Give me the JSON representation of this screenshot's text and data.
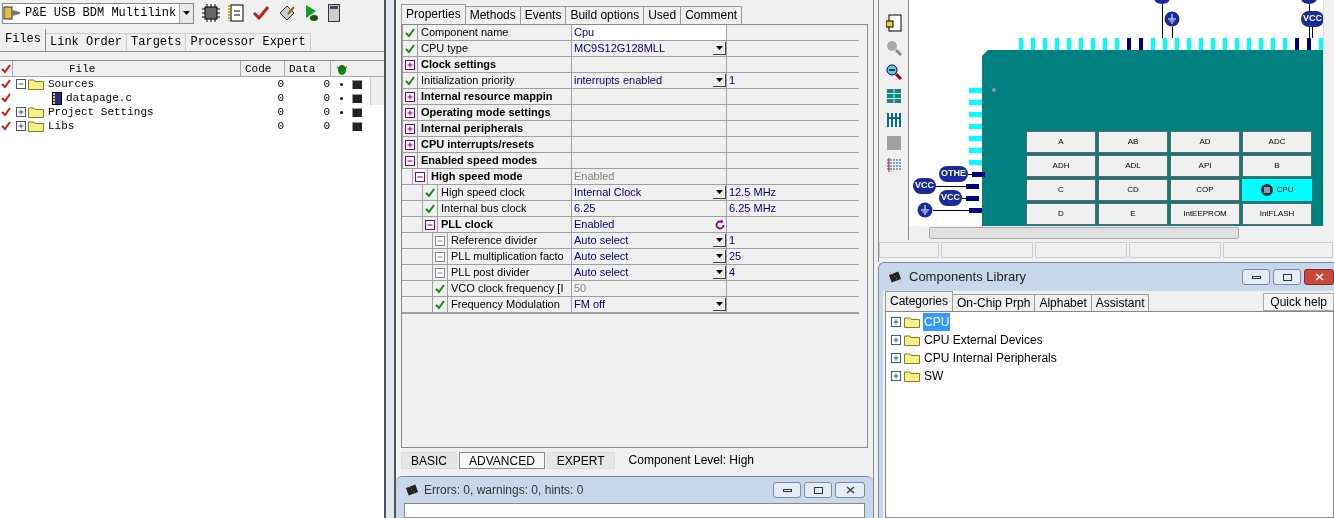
{
  "debugger": {
    "connection": "P&E USB BDM Multilink"
  },
  "project_tabs": [
    {
      "label": "Files",
      "selected": true
    },
    {
      "label": "Link Order",
      "selected": false
    },
    {
      "label": "Targets",
      "selected": false
    },
    {
      "label": "Processor Expert",
      "selected": false
    }
  ],
  "files": {
    "columns": [
      "File",
      "Code",
      "Data"
    ],
    "rows": [
      {
        "name": "Sources",
        "kind": "folder",
        "expanded": true,
        "code": "0",
        "data": "0",
        "debug": true,
        "children": [
          {
            "name": "datapage.c",
            "kind": "file",
            "code": "0",
            "data": "0",
            "debug": true
          }
        ]
      },
      {
        "name": "Project Settings",
        "kind": "folder",
        "expanded": false,
        "code": "0",
        "data": "0",
        "debug": true
      },
      {
        "name": "Libs",
        "kind": "folder",
        "expanded": false,
        "code": "0",
        "data": "0",
        "debug": false
      }
    ]
  },
  "inspector_tabs": [
    {
      "label": "Properties",
      "selected": true
    },
    {
      "label": "Methods",
      "selected": false
    },
    {
      "label": "Events",
      "selected": false
    },
    {
      "label": "Build options",
      "selected": false
    },
    {
      "label": "Used",
      "selected": false
    },
    {
      "label": "Comment",
      "selected": false
    }
  ],
  "properties": [
    {
      "kind": "check",
      "name": "Component name",
      "value": "Cpu",
      "editing": true
    },
    {
      "kind": "check",
      "name": "CPU type",
      "value": "MC9S12G128MLL",
      "dropdown": true
    },
    {
      "kind": "group",
      "name": "Clock settings",
      "expanded": false
    },
    {
      "kind": "check",
      "name": "Initialization priority",
      "value": "interrupts enabled",
      "dropdown": true,
      "extra": "1"
    },
    {
      "kind": "group",
      "name": "Internal resource mappin",
      "expanded": false
    },
    {
      "kind": "group",
      "name": "Operating mode settings",
      "expanded": false
    },
    {
      "kind": "group",
      "name": "Internal peripherals",
      "expanded": false
    },
    {
      "kind": "group",
      "name": "CPU interrupts/resets",
      "expanded": false
    },
    {
      "kind": "group",
      "name": "Enabled speed modes",
      "expanded": true,
      "children": [
        {
          "kind": "group",
          "name": "High speed mode",
          "expanded": true,
          "value": "Enabled",
          "greyed": true,
          "children": [
            {
              "kind": "check",
              "name": "High speed clock",
              "value": "Internal Clock",
              "dropdown": true,
              "extra": "12.5 MHz"
            },
            {
              "kind": "check",
              "name": "Internal bus clock",
              "value": "6.25",
              "extra": "6.25 MHz"
            },
            {
              "kind": "group",
              "name": "PLL clock",
              "expanded": true,
              "value": "Enabled",
              "reset": true,
              "children": [
                {
                  "kind": "fixed",
                  "name": "Reference divider",
                  "value": "Auto select",
                  "dropdown": true,
                  "extra": "1"
                },
                {
                  "kind": "fixed",
                  "name": "PLL multiplication facto",
                  "value": "Auto select",
                  "dropdown": true,
                  "extra": "25"
                },
                {
                  "kind": "fixed",
                  "name": "PLL post divider",
                  "value": "Auto select",
                  "dropdown": true,
                  "extra": "4"
                },
                {
                  "kind": "check",
                  "name": "VCO clock frequency [I",
                  "value": "50",
                  "greyed": true
                },
                {
                  "kind": "check",
                  "name": "Frequency Modulation",
                  "value": "FM off",
                  "dropdown": true
                }
              ]
            }
          ]
        }
      ]
    }
  ],
  "levels": [
    {
      "label": "BASIC",
      "selected": false
    },
    {
      "label": "ADVANCED",
      "selected": true
    },
    {
      "label": "EXPERT",
      "selected": false
    }
  ],
  "component_level": "Component Level: High",
  "errors_window": {
    "title": "Errors: 0, warnings: 0, hints: 0"
  },
  "cpu_view": {
    "top_badges": [
      {
        "kind": "ground"
      },
      {
        "kind": "label",
        "label": "VCC"
      }
    ],
    "left_badges": [
      {
        "kind": "label",
        "label": "OTHE"
      },
      {
        "kind": "label",
        "label": "VCC"
      },
      {
        "kind": "label",
        "label": "VCC"
      },
      {
        "kind": "ground"
      }
    ],
    "blocks": [
      {
        "label": "A",
        "selected": false
      },
      {
        "label": "AB",
        "selected": false
      },
      {
        "label": "AD",
        "selected": false
      },
      {
        "label": "ADC",
        "selected": false
      },
      {
        "label": "ADH",
        "selected": false
      },
      {
        "label": "ADL",
        "selected": false
      },
      {
        "label": "API",
        "selected": false
      },
      {
        "label": "B",
        "selected": false
      },
      {
        "label": "C",
        "selected": false
      },
      {
        "label": "CD",
        "selected": false
      },
      {
        "label": "COP",
        "selected": false
      },
      {
        "label": "CPU",
        "selected": true
      },
      {
        "label": "D",
        "selected": false
      },
      {
        "label": "E",
        "selected": false
      },
      {
        "label": "IntEEPROM",
        "selected": false
      },
      {
        "label": "IntFLASH",
        "selected": false
      }
    ]
  },
  "components_library": {
    "title": "Components Library",
    "tabs": [
      {
        "label": "Categories",
        "selected": true
      },
      {
        "label": "On-Chip Prph",
        "selected": false
      },
      {
        "label": "Alphabet",
        "selected": false
      },
      {
        "label": "Assistant",
        "selected": false
      }
    ],
    "quick_help": "Quick help",
    "categories": [
      {
        "label": "CPU",
        "selected": true,
        "expanded": false
      },
      {
        "label": "CPU External Devices",
        "selected": false,
        "expanded": false
      },
      {
        "label": "CPU Internal Peripherals",
        "selected": false,
        "expanded": false
      },
      {
        "label": "SW",
        "selected": false,
        "expanded": false
      }
    ]
  }
}
